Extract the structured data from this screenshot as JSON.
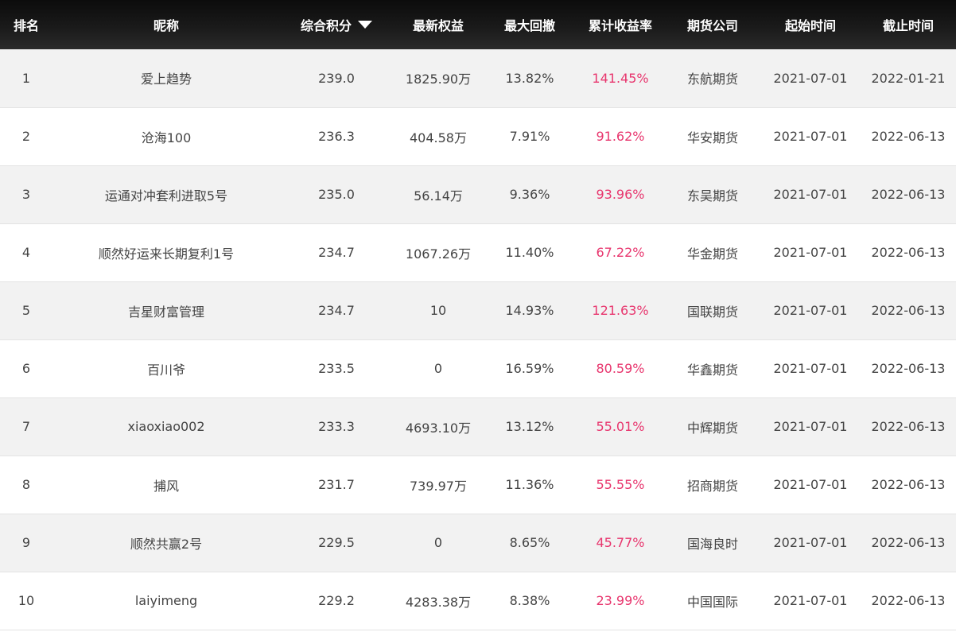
{
  "columns": {
    "rank": "排名",
    "nickname": "昵称",
    "score": "综合积分",
    "equity": "最新权益",
    "drawdown": "最大回撤",
    "return": "累计收益率",
    "company": "期货公司",
    "start": "起始时间",
    "end": "截止时间"
  },
  "sort": {
    "column": "score",
    "direction": "desc",
    "icon": "caret-down-icon"
  },
  "colors": {
    "header_bg": "#111111",
    "return_text": "#e8366e",
    "row_alt": "#f2f2f2",
    "text": "#444444"
  },
  "rows": [
    {
      "rank": "1",
      "nickname": "爱上趋势",
      "score": "239.0",
      "equity": "1825.90万",
      "drawdown": "13.82%",
      "return": "141.45%",
      "company": "东航期货",
      "start": "2021-07-01",
      "end": "2022-01-21"
    },
    {
      "rank": "2",
      "nickname": "沧海100",
      "score": "236.3",
      "equity": "404.58万",
      "drawdown": "7.91%",
      "return": "91.62%",
      "company": "华安期货",
      "start": "2021-07-01",
      "end": "2022-06-13"
    },
    {
      "rank": "3",
      "nickname": "运通对冲套利进取5号",
      "score": "235.0",
      "equity": "56.14万",
      "drawdown": "9.36%",
      "return": "93.96%",
      "company": "东吴期货",
      "start": "2021-07-01",
      "end": "2022-06-13"
    },
    {
      "rank": "4",
      "nickname": "顺然好运来长期复利1号",
      "score": "234.7",
      "equity": "1067.26万",
      "drawdown": "11.40%",
      "return": "67.22%",
      "company": "华金期货",
      "start": "2021-07-01",
      "end": "2022-06-13"
    },
    {
      "rank": "5",
      "nickname": "吉星财富管理",
      "score": "234.7",
      "equity": "10",
      "drawdown": "14.93%",
      "return": "121.63%",
      "company": "国联期货",
      "start": "2021-07-01",
      "end": "2022-06-13"
    },
    {
      "rank": "6",
      "nickname": "百川爷",
      "score": "233.5",
      "equity": "0",
      "drawdown": "16.59%",
      "return": "80.59%",
      "company": "华鑫期货",
      "start": "2021-07-01",
      "end": "2022-06-13"
    },
    {
      "rank": "7",
      "nickname": "xiaoxiao002",
      "score": "233.3",
      "equity": "4693.10万",
      "drawdown": "13.12%",
      "return": "55.01%",
      "company": "中辉期货",
      "start": "2021-07-01",
      "end": "2022-06-13"
    },
    {
      "rank": "8",
      "nickname": "捕风",
      "score": "231.7",
      "equity": "739.97万",
      "drawdown": "11.36%",
      "return": "55.55%",
      "company": "招商期货",
      "start": "2021-07-01",
      "end": "2022-06-13"
    },
    {
      "rank": "9",
      "nickname": "顺然共赢2号",
      "score": "229.5",
      "equity": "0",
      "drawdown": "8.65%",
      "return": "45.77%",
      "company": "国海良时",
      "start": "2021-07-01",
      "end": "2022-06-13"
    },
    {
      "rank": "10",
      "nickname": "laiyimeng",
      "score": "229.2",
      "equity": "4283.38万",
      "drawdown": "8.38%",
      "return": "23.99%",
      "company": "中国国际",
      "start": "2021-07-01",
      "end": "2022-06-13"
    }
  ]
}
